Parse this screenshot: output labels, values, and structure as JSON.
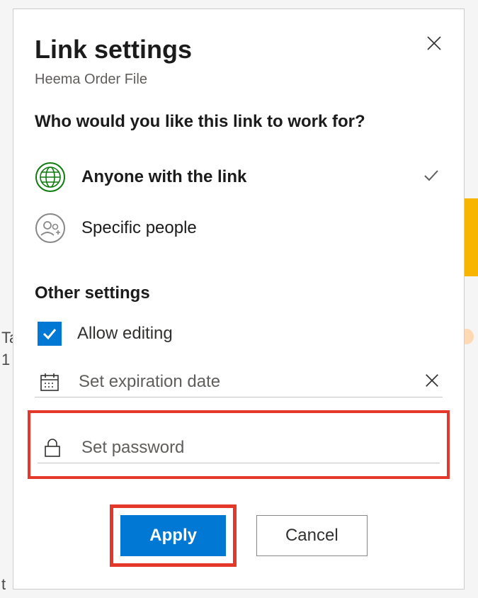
{
  "dialog": {
    "title": "Link settings",
    "subtitle": "Heema Order File",
    "question": "Who would you like this link to work for?"
  },
  "options": {
    "anyone": "Anyone with the link",
    "specific": "Specific people"
  },
  "section": "Other settings",
  "settings": {
    "allow_editing": "Allow editing",
    "expiration_placeholder": "Set expiration date",
    "password_placeholder": "Set password"
  },
  "buttons": {
    "apply": "Apply",
    "cancel": "Cancel"
  },
  "bg": {
    "t1": "Ta",
    "t2": "1",
    "t3": "t"
  }
}
